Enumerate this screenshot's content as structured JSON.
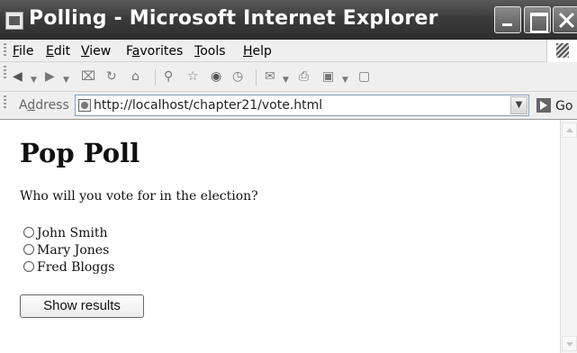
{
  "window": {
    "title": "Polling - Microsoft Internet Explorer"
  },
  "menu": [
    {
      "mnemonic": "F",
      "rest": "ile"
    },
    {
      "mnemonic": "E",
      "rest": "dit"
    },
    {
      "mnemonic": "V",
      "rest": "iew"
    },
    {
      "prefix": "F",
      "mnemonic": "a",
      "rest": "vorites"
    },
    {
      "mnemonic": "T",
      "rest": "ools"
    },
    {
      "mnemonic": "H",
      "rest": "elp"
    }
  ],
  "toolbar_icons": [
    "back-icon",
    "forward-icon",
    "stop-icon",
    "refresh-icon",
    "home-icon",
    "search-icon",
    "favorites-icon",
    "media-icon",
    "history-icon",
    "mail-icon",
    "print-icon",
    "edit-icon",
    "discuss-icon"
  ],
  "address": {
    "label_mnemonic": "d",
    "label_prefix": "A",
    "label_rest": "dress",
    "url": "http://localhost/chapter21/vote.html",
    "go_label": "Go"
  },
  "page": {
    "title": "Pop Poll",
    "question": "Who will you vote for in the election?",
    "options": [
      "John Smith",
      "Mary Jones",
      "Fred Bloggs"
    ],
    "button_label": "Show results"
  }
}
